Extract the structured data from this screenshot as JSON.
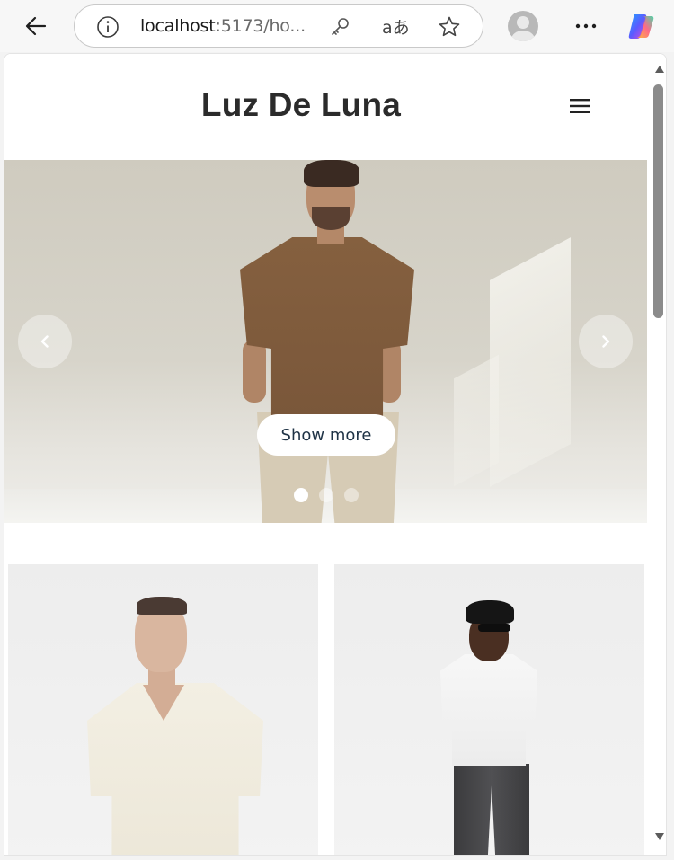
{
  "browser": {
    "url_host": "localhost",
    "url_rest": ":5173/ho...",
    "translate_glyph": "aあ",
    "icons": [
      "back-arrow-icon",
      "info-icon",
      "key-icon",
      "translate-icon",
      "star-icon",
      "profile-icon",
      "more-icon",
      "copilot-icon"
    ]
  },
  "site": {
    "brand": "Luz De Luna",
    "menu_icon": "hamburger-menu-icon"
  },
  "hero": {
    "cta_label": "Show more",
    "slides_count": 3,
    "active_slide": 1,
    "prev_icon": "chevron-left-icon",
    "next_icon": "chevron-right-icon"
  },
  "products": [
    {
      "image": "man-cream-knit-polo"
    },
    {
      "image": "man-white-tee-dark-jeans"
    }
  ],
  "scrollbar": {
    "position_fraction": 0.0
  }
}
